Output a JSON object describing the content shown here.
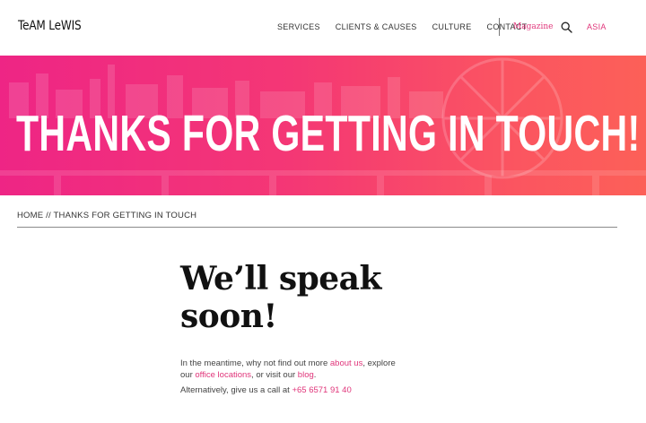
{
  "header": {
    "logo": "TeAM LeWIS",
    "nav": [
      "SERVICES",
      "CLIENTS & CAUSES",
      "CULTURE",
      "CONTACT"
    ],
    "magazine": "Magazine",
    "search_icon": "search-icon",
    "region": "ASIA"
  },
  "hero": {
    "title": "THANKS FOR GETTING IN TOUCH!"
  },
  "breadcrumb": {
    "home": "HOME",
    "separator": " // ",
    "current": "THANKS FOR GETTING IN TOUCH"
  },
  "main": {
    "headline_line1": "We’ll speak",
    "headline_line2": "soon!",
    "intro_1": "In the meantime, why not find out more ",
    "link_about": "about us",
    "intro_2": ", explore our ",
    "link_offices": "office locations",
    "intro_3": ", or visit our ",
    "link_blog": "blog",
    "intro_4": ".",
    "call_text": "Alternatively, give us a call at ",
    "phone": "+65 6571 91 40"
  },
  "colors": {
    "accent": "#e0357a",
    "hero_start": "#ee1d80",
    "hero_end": "#fc5a52"
  }
}
